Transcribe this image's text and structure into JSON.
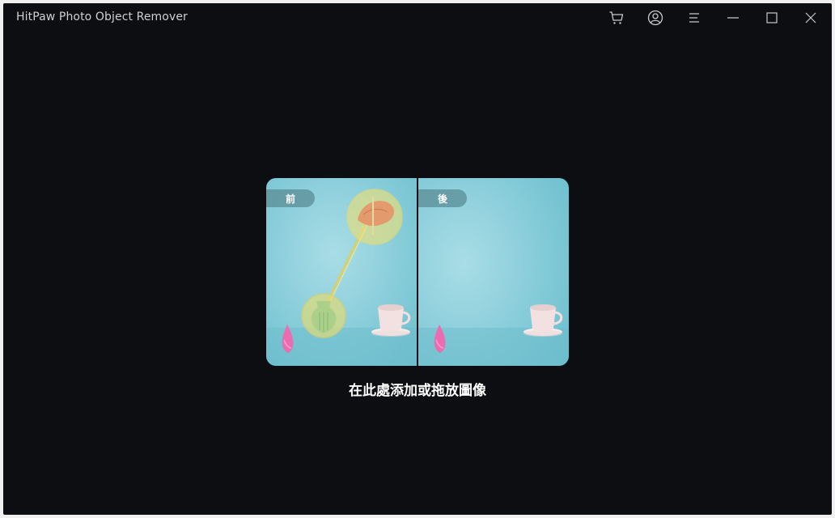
{
  "window": {
    "title": "HitPaw Photo Object Remover",
    "controls": {
      "cart": "cart-icon",
      "account": "user-circle-icon",
      "menu": "menu-icon",
      "minimize": "minimize-icon",
      "maximize": "maximize-icon",
      "close": "close-icon"
    }
  },
  "main": {
    "preview": {
      "before_label": "前",
      "after_label": "後"
    },
    "drop_text": "在此處添加或拖放圖像"
  },
  "colors": {
    "background": "#0d0e12",
    "preview_teal": "#7cc9d6",
    "highlight_yellow": "#e8df7a",
    "title_text": "#cfd0d4"
  }
}
